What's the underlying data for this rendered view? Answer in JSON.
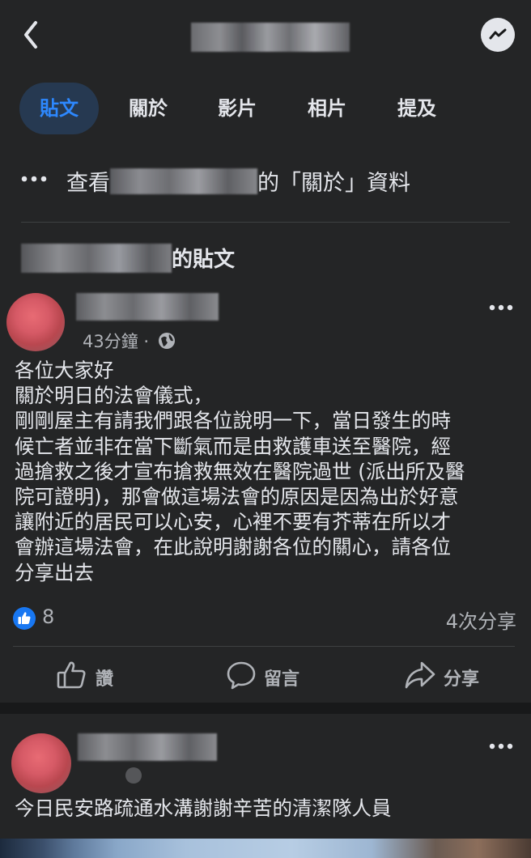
{
  "header": {
    "back_icon": "chevron-left-icon",
    "messenger_icon": "messenger-icon"
  },
  "tabs": [
    {
      "label": "貼文",
      "active": true
    },
    {
      "label": "關於"
    },
    {
      "label": "影片"
    },
    {
      "label": "相片"
    },
    {
      "label": "提及"
    }
  ],
  "about": {
    "prefix": "查看",
    "suffix": "的「關於」資料"
  },
  "posts_section": {
    "suffix": "的貼文"
  },
  "post1": {
    "time": "43分鐘",
    "separator": "·",
    "body_lines": [
      "各位大家好",
      "關於明日的法會儀式，",
      "剛剛屋主有請我們跟各位說明一下，當日發生的時",
      "候亡者並非在當下斷氣而是由救護車送至醫院，經",
      "過搶救之後才宣布搶救無效在醫院過世 (派出所及醫",
      "院可證明)，那會做這場法會的原因是因為出於好意",
      "讓附近的居民可以心安，心裡不要有芥蒂在所以才",
      "會辦這場法會，在此說明謝謝各位的關心，請各位",
      "分享出去"
    ],
    "like_count": "8",
    "share_count": "4次分享",
    "actions": {
      "like": "讚",
      "comment": "留言",
      "share": "分享"
    }
  },
  "post2": {
    "body": "今日民安路疏通水溝謝謝辛苦的清潔隊人員"
  },
  "colors": {
    "accent": "#2d88ff",
    "tab_active_bg": "#263951",
    "like_blue": "#1877f2"
  }
}
